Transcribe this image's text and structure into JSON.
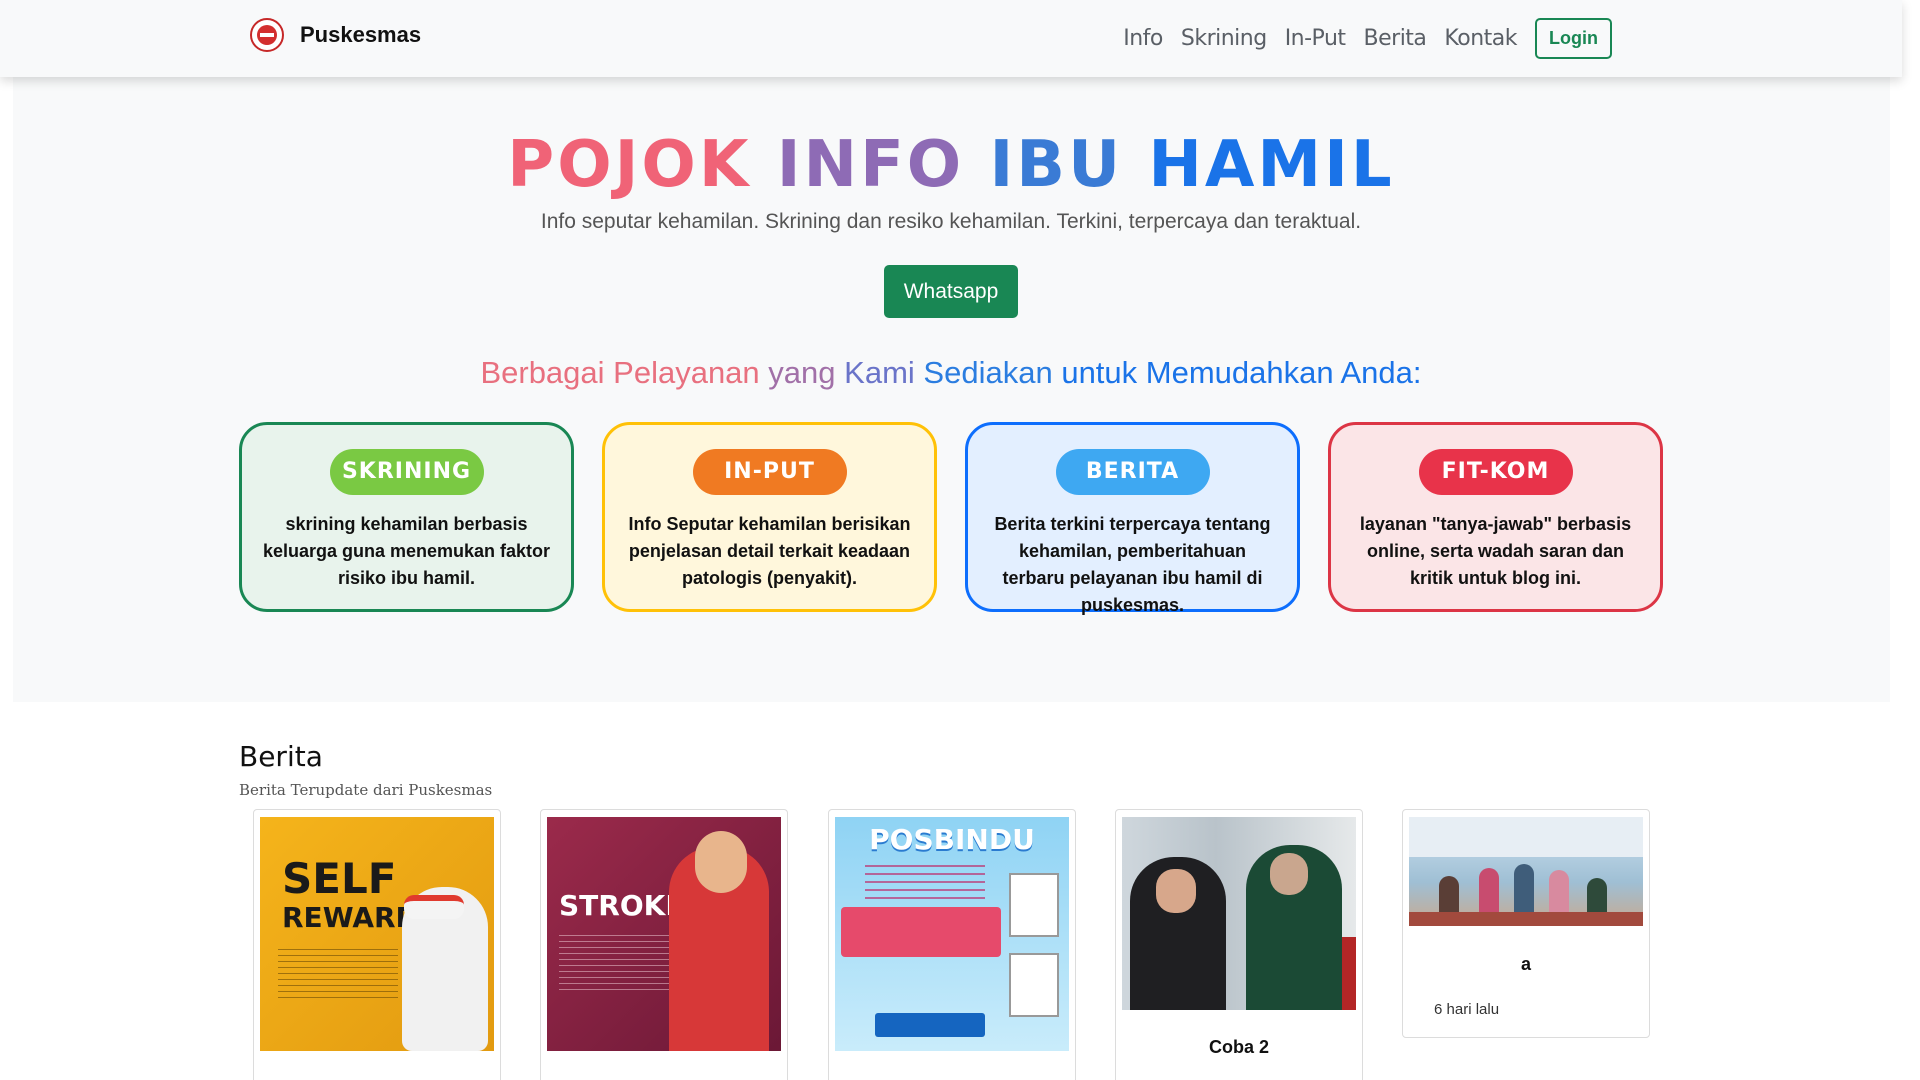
{
  "navbar": {
    "brand": "Puskesmas",
    "links": [
      "Info",
      "Skrining",
      "In-Put",
      "Berita",
      "Kontak"
    ],
    "login": "Login"
  },
  "hero": {
    "title_words": [
      "POJOK",
      "INFO",
      "IBU",
      "HAMIL"
    ],
    "subtitle": "Info seputar kehamilan. Skrining dan resiko kehamilan. Terkini, terpercaya dan teraktual.",
    "whatsapp": "Whatsapp",
    "services_heading_parts": [
      "Berbagai Pelayanan",
      "yang",
      "Kami",
      "Sediakan",
      "untuk Memudahkan Anda:"
    ]
  },
  "services": [
    {
      "label": "SKRINING",
      "desc": "skrining kehamilan berbasis keluarga guna menemukan faktor risiko ibu hamil."
    },
    {
      "label": "IN-PUT",
      "desc": "Info Seputar kehamilan berisikan penjelasan detail terkait keadaan patologis (penyakit)."
    },
    {
      "label": "BERITA",
      "desc": "Berita terkini terpercaya tentang kehamilan, pemberitahuan terbaru pelayanan ibu hamil di puskesmas."
    },
    {
      "label": "FIT-KOM",
      "desc": "layanan \"tanya-jawab\" berbasis online, serta wadah saran dan kritik untuk blog ini."
    }
  ],
  "news": {
    "title": "Berita",
    "subtitle": "Berita Terupdate dari Puskesmas",
    "cards": [
      {
        "image_text_1": "SELF",
        "image_text_2": "REWARD"
      },
      {
        "image_text_1": "STROKE"
      },
      {
        "image_text_1": "POSBINDU"
      },
      {
        "title": "Coba 2"
      },
      {
        "title": "a",
        "time": "6 hari lalu"
      }
    ]
  },
  "colors": {
    "primary_green": "#198754",
    "skrining": "#7ac943",
    "input": "#f07a22",
    "berita": "#3ea8f2",
    "fitkom": "#e8334a"
  }
}
